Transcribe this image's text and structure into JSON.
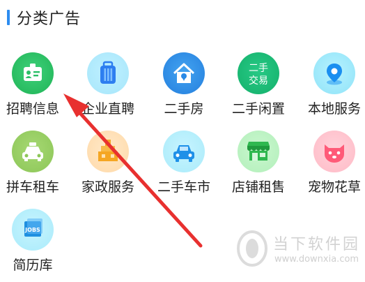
{
  "section": {
    "title": "分类广告"
  },
  "categories": [
    {
      "label": "招聘信息",
      "icon": "id-card-icon",
      "color": "#2bbf67"
    },
    {
      "label": "企业直聘",
      "icon": "suitcase-icon",
      "color": "#2d7ef0"
    },
    {
      "label": "二手房",
      "icon": "house-icon",
      "color": "#2a8ae6"
    },
    {
      "label": "二手闲置",
      "icon": "secondhand-trade-icon",
      "color": "#1db575",
      "badge": "二手交易"
    },
    {
      "label": "本地服务",
      "icon": "location-pin-icon",
      "color": "#1a8ff0"
    },
    {
      "label": "拼车租车",
      "icon": "taxi-icon",
      "color": "#8cc657"
    },
    {
      "label": "家政服务",
      "icon": "house-cleaning-icon",
      "color": "#f5a623"
    },
    {
      "label": "二手车市",
      "icon": "car-icon",
      "color": "#1e90e8"
    },
    {
      "label": "店铺租售",
      "icon": "storefront-icon",
      "color": "#2fb84f"
    },
    {
      "label": "宠物花草",
      "icon": "pet-icon",
      "color": "#ff5a78"
    },
    {
      "label": "简历库",
      "icon": "jobs-resume-icon",
      "color": "#1e8fe0",
      "badge": "JOBS"
    }
  ],
  "watermark": {
    "title": "当下软件园",
    "url": "www.downxia.com"
  },
  "annotation": {
    "type": "arrow",
    "color": "#e8302f"
  }
}
